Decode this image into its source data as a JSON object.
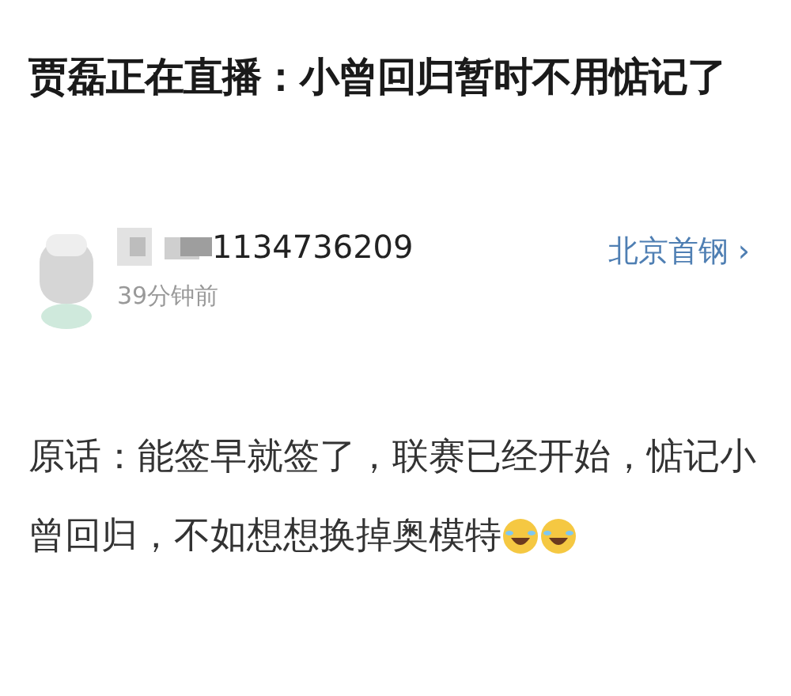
{
  "title": "贾磊正在直播：小曾回归暂时不用惦记了",
  "post": {
    "username": "1134736209",
    "username_blurred": true,
    "time": "39分钟前",
    "team_link": "北京首钢",
    "chevron": "›",
    "text_lines": [
      "原话：能签早就签了，联赛已经开始，惦记小",
      "曾回归，不如想想换掉奥模特"
    ],
    "emojis": [
      {
        "kind": "laughing"
      },
      {
        "kind": "laughing"
      }
    ]
  }
}
